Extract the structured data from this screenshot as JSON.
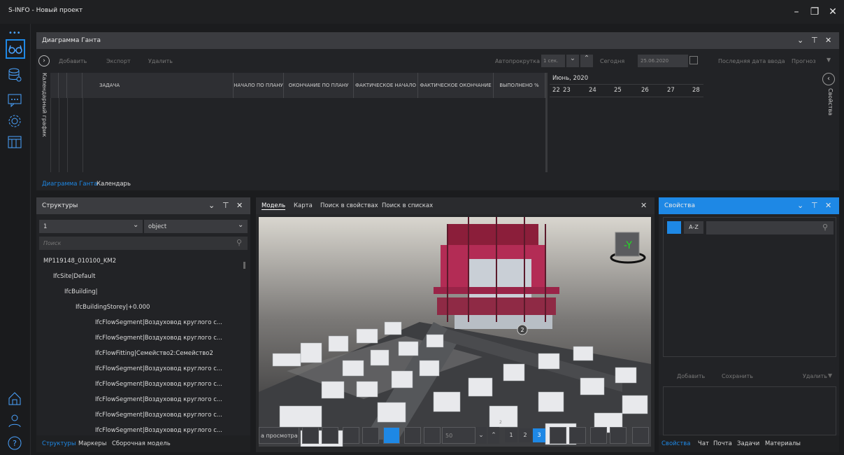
{
  "window": {
    "title": "S-INFO - Новый проект"
  },
  "gantt": {
    "panel_title": "Диаграмма Ганта",
    "toolbar": {
      "add": "Добавить",
      "export": "Экспорт",
      "delete": "Удалить",
      "autoscroll_label": "Автопрокрутка",
      "autoscroll_value": "1 сек.",
      "today": "Сегодня",
      "date": "25.06.2020",
      "last_date": "Последняя дата ввода",
      "forecast": "Прогноз"
    },
    "side_label": "Календарный график",
    "columns": [
      "ЗАДАЧА",
      "НАЧАЛО ПО ПЛАНУ",
      "ОКОНЧАНИЕ ПО ПЛАНУ",
      "ФАКТИЧЕСКОЕ НАЧАЛО",
      "ФАКТИЧЕСКОЕ ОКОНЧАНИЕ",
      "ВЫПОЛНЕНО %"
    ],
    "month": "Июнь, 2020",
    "days": [
      "22",
      "23",
      "24",
      "25",
      "26",
      "27",
      "28"
    ],
    "right_label": "Свойства",
    "tabs": [
      "Диаграмма Ганта",
      "Календарь"
    ]
  },
  "structure": {
    "panel_title": "Структуры",
    "select1": "1",
    "select2": "object",
    "search_placeholder": "Поиск",
    "tree": [
      {
        "label": "MP119148_010100_KM2",
        "depth": 0
      },
      {
        "label": "IfcSite|Default",
        "depth": 1
      },
      {
        "label": "IfcBuilding|",
        "depth": 2
      },
      {
        "label": "IfcBuildingStorey|+0.000",
        "depth": 3
      },
      {
        "label": "IfcFlowSegment|Воздуховод круглого с...",
        "depth": 4
      },
      {
        "label": "IfcFlowSegment|Воздуховод круглого с...",
        "depth": 4
      },
      {
        "label": "IfcFlowFitting|Семейство2:Семейство2",
        "depth": 4
      },
      {
        "label": "IfcFlowSegment|Воздуховод круглого с...",
        "depth": 4
      },
      {
        "label": "IfcFlowSegment|Воздуховод круглого с...",
        "depth": 4
      },
      {
        "label": "IfcFlowSegment|Воздуховод круглого с...",
        "depth": 4
      },
      {
        "label": "IfcFlowSegment|Воздуховод круглого с...",
        "depth": 4
      },
      {
        "label": "IfcFlowSegment|Воздуховод круглого с...",
        "depth": 4
      }
    ],
    "tabs": [
      "Структуры",
      "Маркеры",
      "Сборочная модель"
    ]
  },
  "viewer": {
    "tabs": [
      "Модель",
      "Карта",
      "Поиск в свойствах",
      "Поиск в списках"
    ],
    "cube_label": "-Y",
    "marker": "2",
    "toolbar": {
      "view_label": "а просмотра",
      "speed": "50",
      "pages": [
        "1",
        "2",
        "3"
      ],
      "small_num": "2"
    }
  },
  "properties": {
    "panel_title": "Свойства",
    "sort_az": "A-Z",
    "buttons": {
      "add": "Добавить",
      "save": "Сохранить",
      "delete": "Удалить"
    },
    "tabs": [
      "Свойства",
      "Чат",
      "Почта",
      "Задачи",
      "Материалы"
    ]
  },
  "colors": {
    "accent": "#1e88e5",
    "header": "#3b3c40",
    "bg": "#1b1c1e"
  }
}
